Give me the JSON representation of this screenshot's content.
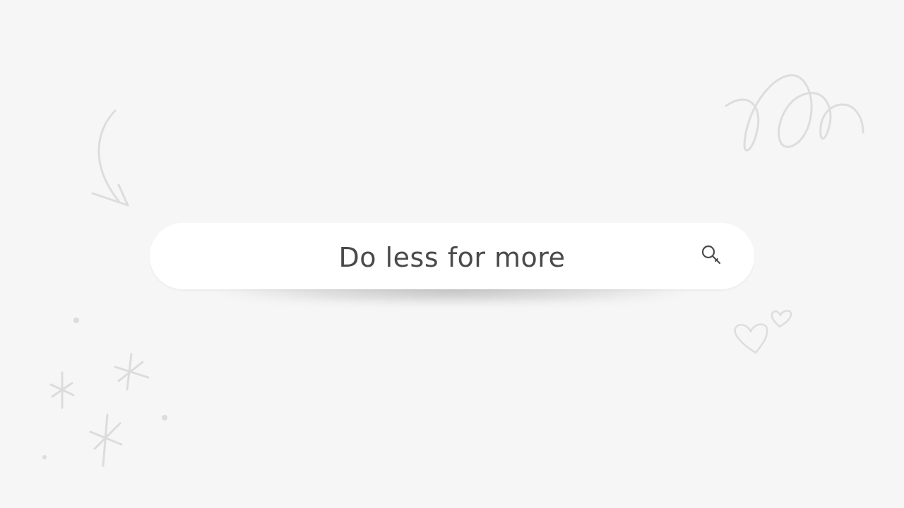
{
  "search": {
    "text": "Do less for more",
    "icon": "search-icon"
  },
  "decorations": {
    "stroke_color": "#dcdcdc",
    "icons": [
      "curved-arrow-icon",
      "spiral-scribble-icon",
      "hearts-icon",
      "sparkles-icon"
    ]
  },
  "colors": {
    "background": "#f6f6f6",
    "search_bar": "#ffffff",
    "text": "#4a4a4a"
  }
}
